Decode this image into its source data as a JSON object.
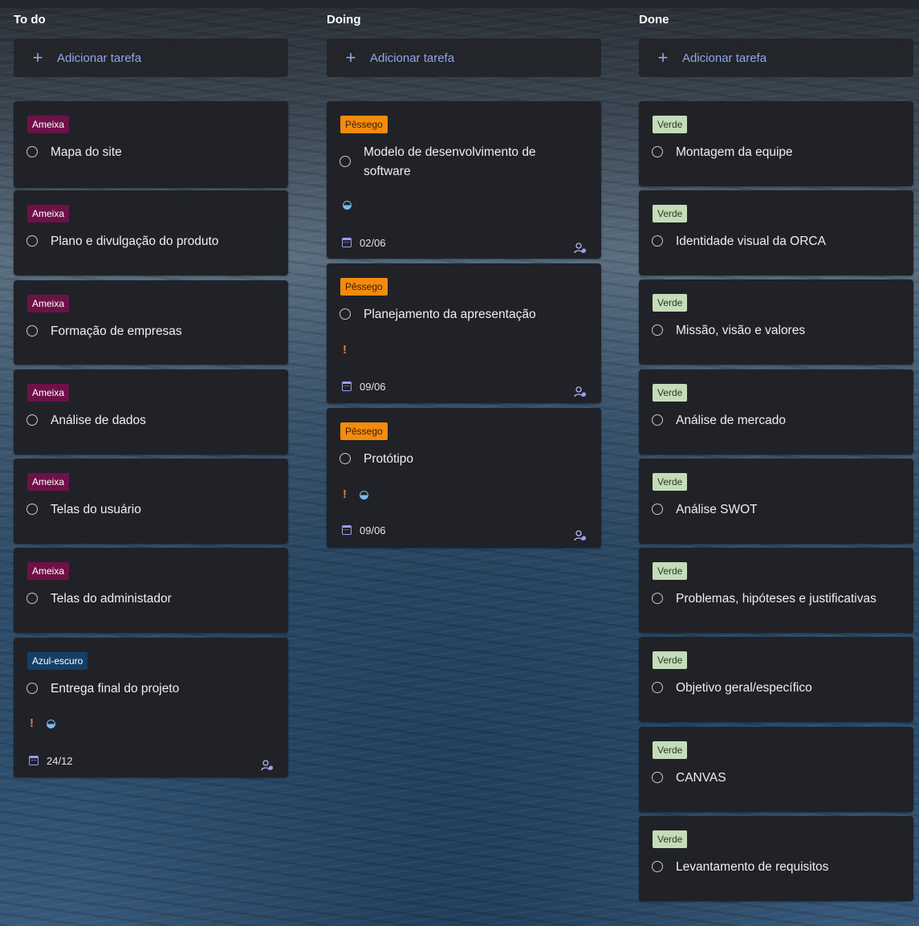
{
  "colors": {
    "card_bg": "#202227",
    "add_text": "#8fa8e8",
    "tag_ameixa": "#6e1148",
    "tag_pessego": "#f38b0e",
    "tag_verde": "#c4dcb8",
    "tag_azul": "#143f68",
    "important": "#f3793b",
    "progress": "#7bbcf0"
  },
  "icons": {
    "add": "plus-icon",
    "task_status": "circle-icon",
    "important": "exclamation-icon",
    "progress": "half-circle-icon",
    "due_date": "calendar-icon",
    "assign": "assign-user-icon"
  },
  "columns": {
    "todo": {
      "title": "To do",
      "add_label": "Adicionar tarefa",
      "cards": [
        {
          "tag": "Ameixa",
          "title": "Mapa do site"
        },
        {
          "tag": "Ameixa",
          "title": "Plano e divulgação do produto"
        },
        {
          "tag": "Ameixa",
          "title": "Formação de empresas"
        },
        {
          "tag": "Ameixa",
          "title": "Análise de dados"
        },
        {
          "tag": "Ameixa",
          "title": "Telas do usuário"
        },
        {
          "tag": "Ameixa",
          "title": "Telas do administador"
        },
        {
          "tag": "Azul-escuro",
          "title": "Entrega final do projeto",
          "due": "24/12"
        }
      ]
    },
    "doing": {
      "title": "Doing",
      "add_label": "Adicionar tarefa",
      "cards": [
        {
          "tag": "Pêssego",
          "title": "Modelo de desenvolvimento de software",
          "due": "02/06"
        },
        {
          "tag": "Pêssego",
          "title": "Planejamento da apresentação",
          "due": "09/06"
        },
        {
          "tag": "Pêssego",
          "title": "Protótipo",
          "due": "09/06"
        }
      ]
    },
    "done": {
      "title": "Done",
      "add_label": "Adicionar tarefa",
      "cards": [
        {
          "tag": "Verde",
          "title": "Montagem da equipe"
        },
        {
          "tag": "Verde",
          "title": "Identidade visual da ORCA"
        },
        {
          "tag": "Verde",
          "title": "Missão, visão e valores"
        },
        {
          "tag": "Verde",
          "title": "Análise de mercado"
        },
        {
          "tag": "Verde",
          "title": "Análise SWOT"
        },
        {
          "tag": "Verde",
          "title": "Problemas, hipóteses e justificativas"
        },
        {
          "tag": "Verde",
          "title": "Objetivo geral/específico"
        },
        {
          "tag": "Verde",
          "title": "CANVAS"
        },
        {
          "tag": "Verde",
          "title": "Levantamento de requisitos"
        }
      ]
    }
  }
}
